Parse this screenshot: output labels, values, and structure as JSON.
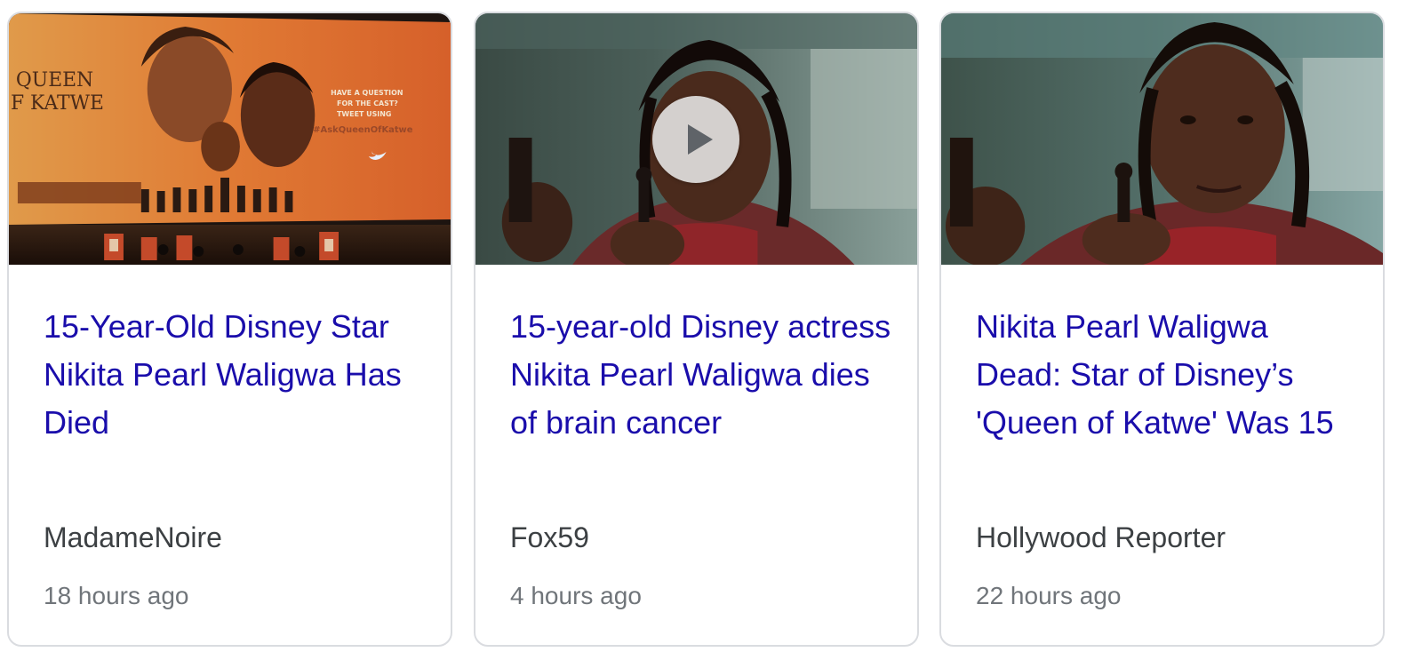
{
  "cards": [
    {
      "title": "15-Year-Old Disney Star Nikita Pearl Waligwa Has Died",
      "source": "MadameNoire",
      "time": "18 hours ago",
      "thumbnail_icon": "movie-premiere-image",
      "poster_title_line1": "QUEEN",
      "poster_title_line2": "F KATWE",
      "poster_text_line1": "HAVE A QUESTION",
      "poster_text_line2": "FOR THE CAST?",
      "poster_text_line3": "TWEET USING",
      "poster_hashtag": "#AskQueenOfKatwe"
    },
    {
      "title": "15-year-old Disney actress Nikita Pearl Waligwa dies of brain cancer",
      "source": "Fox59",
      "time": "4 hours ago",
      "thumbnail_icon": "girl-with-chess-piece-image",
      "has_video": true
    },
    {
      "title": "Nikita Pearl Waligwa Dead: Star of Disney’s 'Queen of Katwe' Was 15",
      "source": "Hollywood Reporter",
      "time": "22 hours ago",
      "thumbnail_icon": "girl-with-chess-piece-image"
    }
  ],
  "colors": {
    "title_link": "#1a0dab",
    "source_text": "#3c4043",
    "time_text": "#70757a",
    "card_border": "#dadce0"
  }
}
